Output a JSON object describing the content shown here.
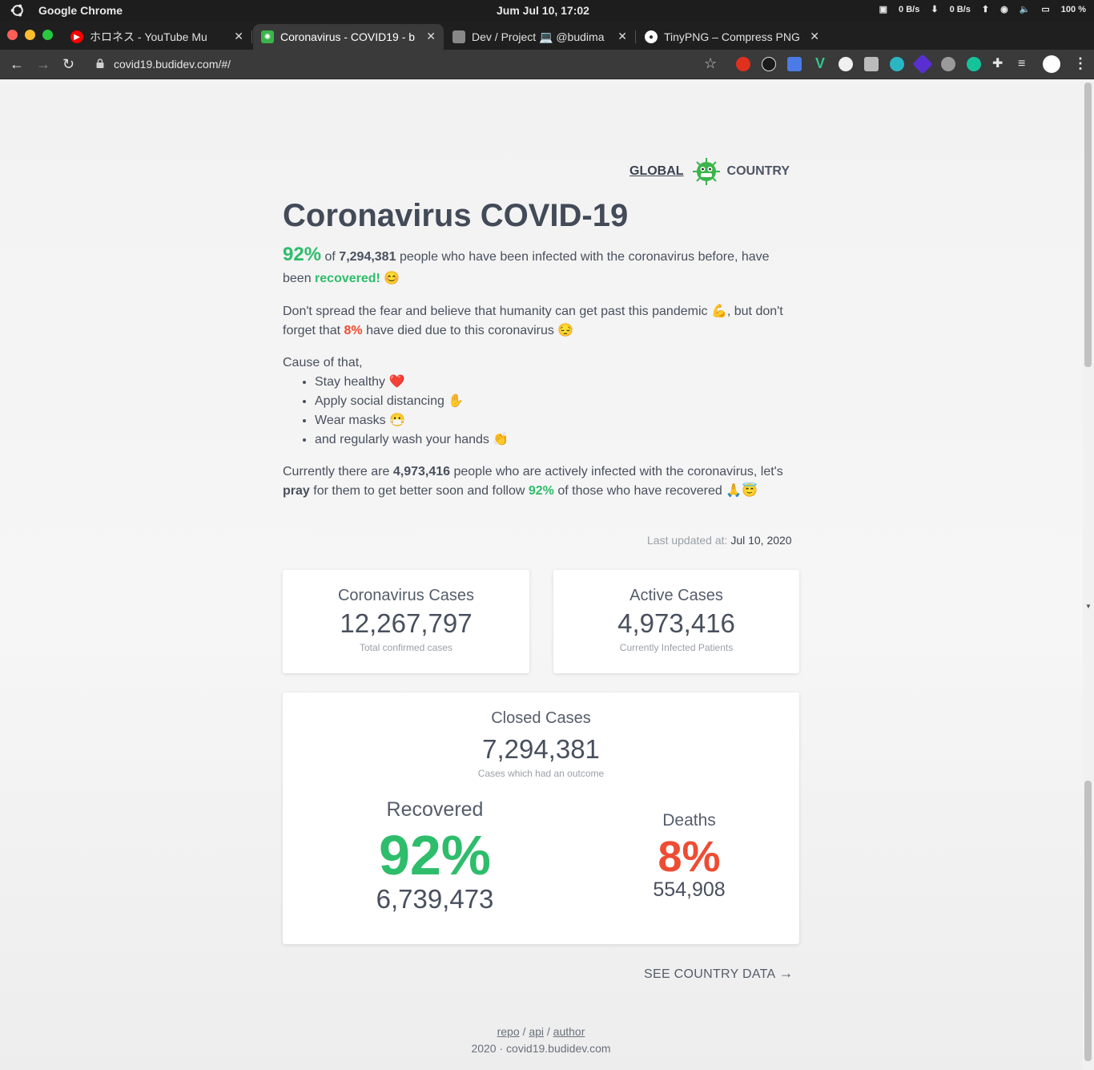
{
  "system_bar": {
    "app_name": "Google Chrome",
    "clock": "Jum Jul 10, 17:02",
    "net_down": "0 B/s",
    "net_up": "0 B/s",
    "battery": "100 %"
  },
  "tabs": [
    {
      "title": "ホロネス - YouTube Mu",
      "favicon_color": "#ff0000"
    },
    {
      "title": "Coronavirus - COVID19 - b",
      "favicon_color": "#3ab54a"
    },
    {
      "title": "Dev / Project 💻 @budima",
      "favicon_color": "#888888"
    },
    {
      "title": "TinyPNG – Compress PNG",
      "favicon_color": "#ffffff"
    }
  ],
  "toolbar": {
    "url": "covid19.budidev.com/#/"
  },
  "nav": {
    "global": "GLOBAL",
    "country": "COUNTRY"
  },
  "page": {
    "title": "Coronavirus COVID-19",
    "intro": {
      "percent": "92%",
      "of": "of",
      "closed_total": "7,294,381",
      "text1": "people who have been infected with the coronavirus before, have been",
      "recovered_word": "recovered!",
      "emoji": "😊"
    },
    "para2": {
      "text1": "Don't spread the fear and believe that humanity can get past this pandemic 💪, but don't forget that",
      "death_percent": "8%",
      "text2": "have died due to this coronavirus 😔"
    },
    "cause_intro": "Cause of that,",
    "tips": [
      "Stay healthy ❤️",
      "Apply social distancing ✋",
      "Wear masks 😷",
      "and regularly wash your hands 👏"
    ],
    "para4": {
      "text1": "Currently there are",
      "active": "4,973,416",
      "text2": "people who are actively infected with the coronavirus, let's",
      "pray": "pray",
      "text3": "for them to get better soon and follow",
      "percent": "92%",
      "text4": "of those who have recovered 🙏😇"
    },
    "last_updated_label": "Last updated at:",
    "last_updated": "Jul 10, 2020"
  },
  "cards": {
    "total": {
      "title": "Coronavirus Cases",
      "value": "12,267,797",
      "sub": "Total confirmed cases"
    },
    "active": {
      "title": "Active Cases",
      "value": "4,973,416",
      "sub": "Currently Infected Patients"
    },
    "closed": {
      "title": "Closed Cases",
      "value": "7,294,381",
      "sub": "Cases which had an outcome"
    },
    "recovered": {
      "label": "Recovered",
      "percent": "92%",
      "value": "6,739,473"
    },
    "deaths": {
      "label": "Deaths",
      "percent": "8%",
      "value": "554,908"
    }
  },
  "see_country": "SEE COUNTRY DATA",
  "footer": {
    "repo": "repo",
    "api": "api",
    "author": "author",
    "sep": "/",
    "copyright": "2020 · covid19.budidev.com"
  }
}
